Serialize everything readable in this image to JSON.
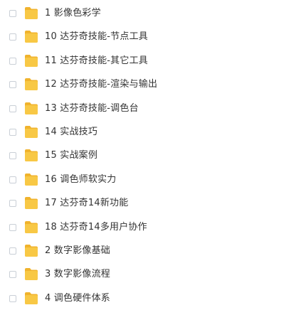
{
  "folder_color": "#f8c845",
  "folder_tab_color": "#f0b32d",
  "items": [
    {
      "label": "1 影像色彩学",
      "icon": "folder-icon"
    },
    {
      "label": "10 达芬奇技能-节点工具",
      "icon": "folder-icon"
    },
    {
      "label": "11 达芬奇技能-其它工具",
      "icon": "folder-icon"
    },
    {
      "label": "12 达芬奇技能-渲染与输出",
      "icon": "folder-icon"
    },
    {
      "label": "13 达芬奇技能-调色台",
      "icon": "folder-icon"
    },
    {
      "label": "14 实战技巧",
      "icon": "folder-icon"
    },
    {
      "label": "15 实战案例",
      "icon": "folder-icon"
    },
    {
      "label": "16 调色师软实力",
      "icon": "folder-icon"
    },
    {
      "label": "17 达芬奇14新功能",
      "icon": "folder-icon"
    },
    {
      "label": "18 达芬奇14多用户协作",
      "icon": "folder-icon"
    },
    {
      "label": "2 数字影像基础",
      "icon": "folder-icon"
    },
    {
      "label": "3 数字影像流程",
      "icon": "folder-icon"
    },
    {
      "label": "4 调色硬件体系",
      "icon": "folder-icon"
    }
  ]
}
